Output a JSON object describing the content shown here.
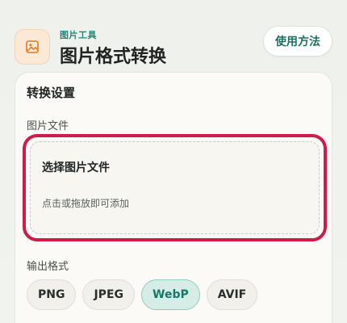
{
  "header": {
    "subtitle": "图片工具",
    "title": "图片格式转换",
    "help_label": "使用方法",
    "icon": "image-icon"
  },
  "settings": {
    "title": "转换设置",
    "file_label": "图片文件",
    "drop_title": "选择图片文件",
    "drop_hint": "点击或拖放即可添加",
    "format_label": "输出格式",
    "formats": [
      "PNG",
      "JPEG",
      "WebP",
      "AVIF"
    ],
    "selected_format": "WebP"
  },
  "colors": {
    "accent": "#1d8b7e",
    "highlight": "#d11a4a",
    "icon_bg": "#fbe9d6"
  }
}
